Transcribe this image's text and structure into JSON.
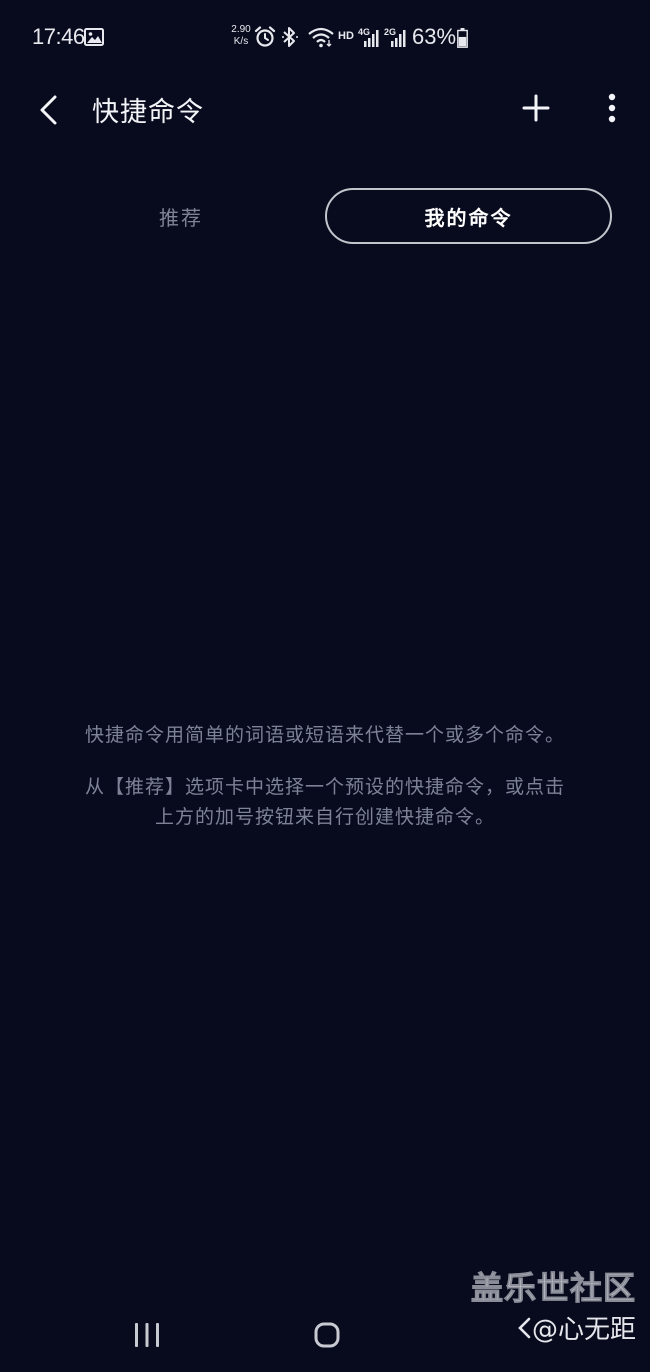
{
  "status_bar": {
    "time": "17:46",
    "net_speed_value": "2.90",
    "net_speed_unit": "K/s",
    "hd_label": "HD",
    "battery_percent": "63%",
    "battery_level": 0.63,
    "icons": [
      "gallery-icon",
      "alarm-icon",
      "bluetooth-icon",
      "wifi-icon",
      "signal-4g-icon",
      "signal-2g-icon",
      "battery-icon"
    ]
  },
  "app_bar": {
    "title": "快捷命令",
    "back_icon": "chevron-left-icon",
    "add_icon": "plus-icon",
    "more_icon": "more-vertical-icon"
  },
  "tabs": [
    {
      "label": "推荐",
      "selected": false
    },
    {
      "label": "我的命令",
      "selected": true
    }
  ],
  "empty_state": {
    "line1": "快捷命令用简单的词语或短语来代替一个或多个命令。",
    "line2a": "从【推荐】选项卡中选择一个预设的快捷命令，或点击",
    "line2b": "上方的加号按钮来自行创建快捷命令。"
  },
  "watermark": {
    "title": "盖乐世社区",
    "user": "@心无距"
  },
  "nav_bar": {
    "icons": [
      "recents-icon",
      "home-icon",
      "back-icon"
    ]
  },
  "colors": {
    "background": "#080b1e",
    "text_primary": "#ffffff",
    "text_secondary": "#7e8296",
    "tab_border": "#c3c5cd"
  }
}
